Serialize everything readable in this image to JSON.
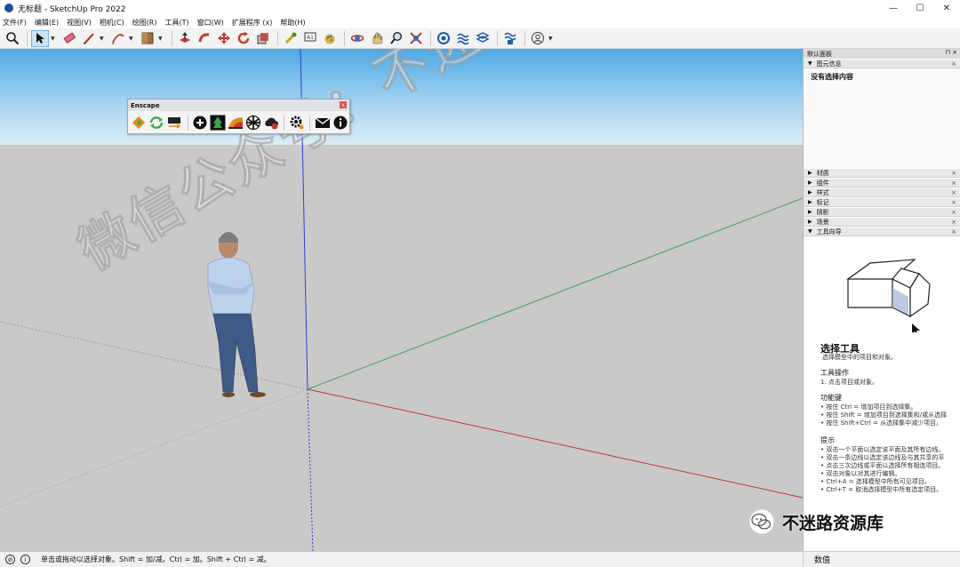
{
  "window": {
    "title": "无标题 - SketchUp Pro 2022",
    "controls": [
      "—",
      "☐",
      "✕"
    ]
  },
  "menu": [
    "文件(F)",
    "编辑(E)",
    "视图(V)",
    "相机(C)",
    "绘图(R)",
    "工具(T)",
    "窗口(W)",
    "扩展程序 (x)",
    "帮助(H)"
  ],
  "toolbar": {
    "tools": [
      "search-icon",
      "select-arrow-icon",
      "eraser-icon",
      "pencil-line-icon",
      "arc-icon",
      "paint-bucket-icon",
      "push-pull-icon",
      "follow-me-icon",
      "move-icon",
      "rotate-icon",
      "scale-icon",
      "tape-measure-icon",
      "text-icon",
      "paint-icon",
      "orbit-icon",
      "pan-icon",
      "zoom-icon",
      "zoom-extents-icon",
      "warehouse-icon",
      "extension-warehouse-icon",
      "layout-icon",
      "extension-manager-icon",
      "user-account-icon"
    ]
  },
  "enscape": {
    "title": "Enscape",
    "buttons": [
      "start-enscape-icon",
      "live-update-icon",
      "sync-views-icon",
      "add-asset-icon",
      "asset-library-icon",
      "material-editor-icon",
      "render-icon",
      "upload-icon",
      "settings-icon",
      "feedback-icon",
      "about-icon"
    ]
  },
  "watermark": "微信公众号：不迷路资源库",
  "panel": {
    "title": "默认面板",
    "entity_info": {
      "label": "图元信息",
      "content": "没有选择内容"
    },
    "trays": [
      "材质",
      "组件",
      "样式",
      "标记",
      "阴影",
      "场景"
    ],
    "instructor": {
      "label": "工具向导",
      "tool_title": "选择工具",
      "tool_sub": "选择模型中的项目和对象。",
      "ops_title": "工具操作",
      "ops": [
        "1. 点击项目或对象。"
      ],
      "keys_title": "功能键",
      "keys": [
        "• 按住 Ctrl = 增加项目到选择集。",
        "• 按住 Shift = 增加项目到选择集和/或从选择",
        "• 按住 Shift+Ctrl = 从选择集中减少项目。"
      ],
      "tips_title": "提示",
      "tips": [
        "• 双击一个平面以选定该平面及其所有边线。",
        "• 双击一条边线以选定该边线及与其共享的平",
        "• 点击三次边线或平面以选择所有相连项目。",
        "• 双击对象以对其进行编辑。",
        "• Ctrl+A = 选择模型中所有可见项目。",
        "• Ctrl+T = 取消选择模型中所有选定项目。"
      ]
    }
  },
  "wechat_badge": "不迷路资源库",
  "status": {
    "text": "单击或拖动以选择对象。Shift = 加/减。Ctrl = 加。Shift + Ctrl = 减。",
    "measure_label": "数值"
  },
  "colors": {
    "sky_top": "#4fa9e3",
    "ground": "#c9c9ca",
    "axis_red": "#c0392b",
    "axis_green": "#3aa655",
    "axis_blue": "#2c3fd6"
  }
}
